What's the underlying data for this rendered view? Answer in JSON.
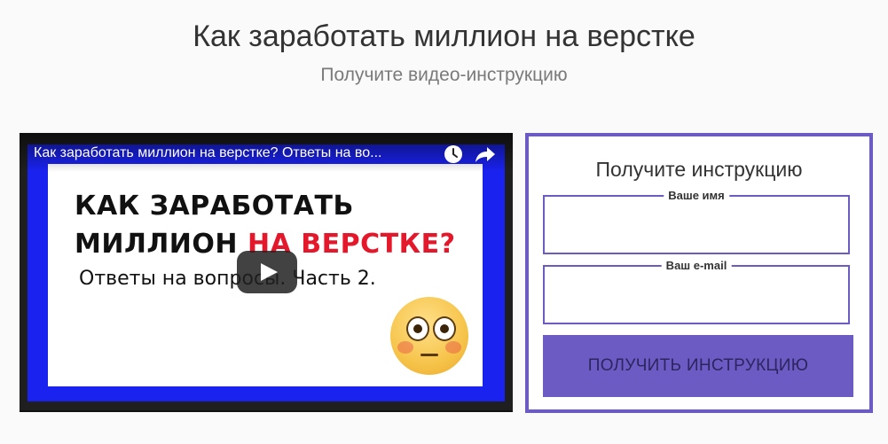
{
  "header": {
    "title": "Как заработать миллион на верстке",
    "subtitle": "Получите видео-инструкцию"
  },
  "video": {
    "title": "Как заработать миллион на верстке? Ответы на во...",
    "thumbnail": {
      "line1": "КАК ЗАРАБОТАТЬ",
      "line2_black": "МИЛЛИОН ",
      "line2_red": "НА ВЕРСТКЕ?",
      "line3": "Ответы на вопросы. Часть 2."
    },
    "icons": {
      "watch_later": "clock-icon",
      "share": "share-arrow-icon",
      "play": "play-icon",
      "emoji": "flushed-face-emoji"
    }
  },
  "form": {
    "title": "Получите инструкцию",
    "name_label": "Ваше имя",
    "name_value": "",
    "email_label": "Ваш e-mail",
    "email_value": "",
    "submit_label": "ПОЛУЧИТЬ ИНСТРУКЦИЮ"
  },
  "colors": {
    "accent": "#6d5bc4",
    "thumb_blue": "#1a22f0",
    "thumb_red": "#e5172a"
  }
}
